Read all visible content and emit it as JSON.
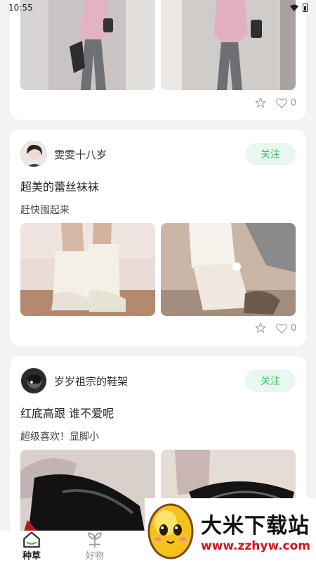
{
  "status": {
    "time": "10:55"
  },
  "posts": [
    {
      "likes": "0"
    },
    {
      "author": "雯雯十八岁",
      "follow_label": "关注",
      "title": "超美的蕾丝袜袜",
      "desc": "赶快囤起来",
      "likes": "0"
    },
    {
      "author": "岁岁祖宗的鞋架",
      "follow_label": "关注",
      "title": "红底高跟 谁不爱呢",
      "desc": "超级喜欢！显脚小"
    }
  ],
  "nav": {
    "items": [
      {
        "label": "种草"
      },
      {
        "label": "好物"
      }
    ]
  },
  "watermark": {
    "brand": "大米下载站",
    "url": "www.zzhyw.com"
  },
  "colors": {
    "accent": "#3cbf6c",
    "follow_bg": "#e9f8ee",
    "watermark_red": "#d0141e"
  }
}
